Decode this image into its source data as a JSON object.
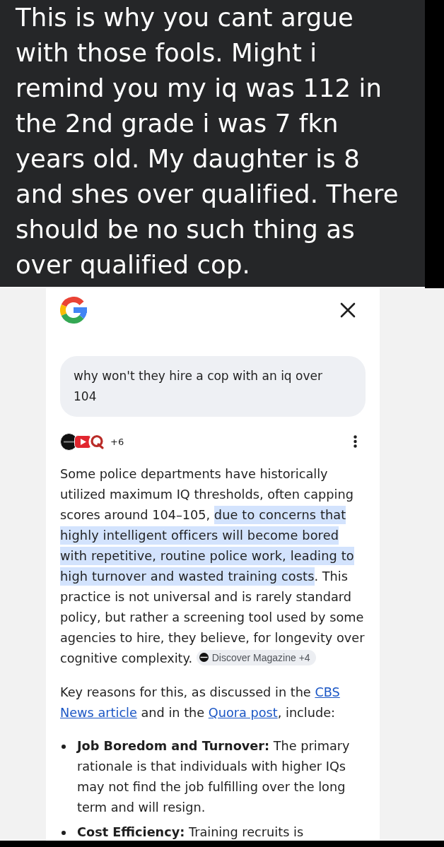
{
  "post": {
    "caption": "This is why you cant argue with those fools. Might i remind you my iq was 112 in the 2nd grade i was 7 fkn years old. My daughter is 8 and shes over qualified. There should be no such thing as over qualified cop."
  },
  "ai_overview": {
    "query": "why won't they hire a cop with an iq over 104",
    "sources_more": "+6",
    "answer": {
      "segments": [
        {
          "text": "Some police departments have historically utilized maximum IQ thresholds, often capping scores around 104–105, ",
          "highlighted": false
        },
        {
          "text": "due to concerns that highly intelligent officers will become bored with repetitive, routine police work, leading to high turnover and wasted training costs",
          "highlighted": true
        },
        {
          "text": ". This practice is not universal and is rarely standard policy, but rather a screening tool used by some agencies to hire, they believe, for longevity over cognitive complexity. ",
          "highlighted": false
        }
      ],
      "citation": "Discover Magazine +4"
    },
    "intro": {
      "segments": [
        {
          "kind": "text",
          "text": "Key reasons for this, as discussed in the "
        },
        {
          "kind": "link",
          "text": "CBS"
        },
        {
          "kind": "link",
          "text": "News article"
        },
        {
          "kind": "text",
          "text": " and in the "
        },
        {
          "kind": "link",
          "text": "Quora post"
        },
        {
          "kind": "text",
          "text": ", include:"
        }
      ]
    },
    "reasons": [
      {
        "text": "**Job Boredom and Turnover:** The primary rationale is that individuals with higher IQs may not find the job fulfilling over the long term and will resign."
      },
      {
        "text": "**Cost Efficiency:** Training recruits is"
      }
    ]
  }
}
